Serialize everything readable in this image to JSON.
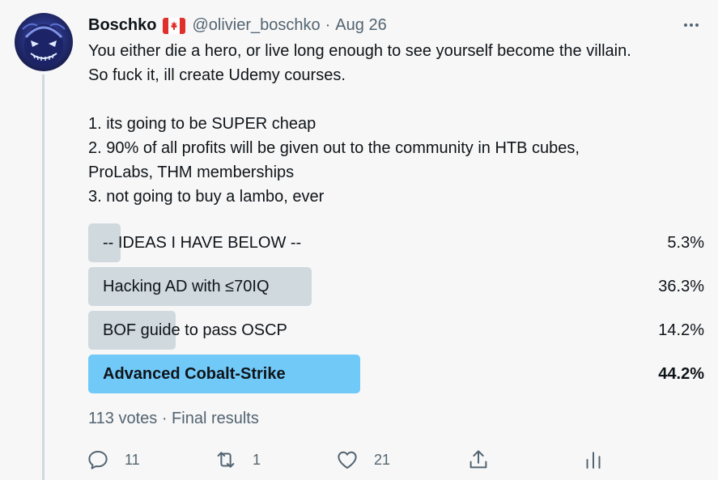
{
  "tweet": {
    "display_name": "Boschko",
    "flag_icon": "canada-flag-icon",
    "handle": "@olivier_boschko",
    "separator": "·",
    "date": "Aug 26",
    "more_icon": "more-options-icon",
    "text": "You either die a hero, or live long enough to see yourself become the villain.\nSo fuck it, ill create Udemy courses.\n\n1. its going to be SUPER cheap\n2. 90% of all profits will be given out to the community in HTB cubes,\nProLabs, THM memberships\n3. not going to buy a lambo, ever"
  },
  "poll": {
    "options": [
      {
        "label": "-- IDEAS I HAVE BELOW --",
        "percent_text": "5.3%",
        "percent": 5.3,
        "winner": false
      },
      {
        "label": "Hacking AD with ≤70IQ",
        "percent_text": "36.3%",
        "percent": 36.3,
        "winner": false
      },
      {
        "label": "BOF guide to pass OSCP",
        "percent_text": "14.2%",
        "percent": 14.2,
        "winner": false
      },
      {
        "label": "Advanced Cobalt-Strike",
        "percent_text": "44.2%",
        "percent": 44.2,
        "winner": true
      }
    ],
    "votes": "113 votes",
    "separator": "·",
    "status": "Final results"
  },
  "actions": {
    "reply_count": "11",
    "retweet_count": "1",
    "like_count": "21"
  },
  "colors": {
    "bar": "#cfd9de",
    "winner_bar": "#71c9f8",
    "muted_text": "#536471",
    "background": "#f7f7f7"
  }
}
